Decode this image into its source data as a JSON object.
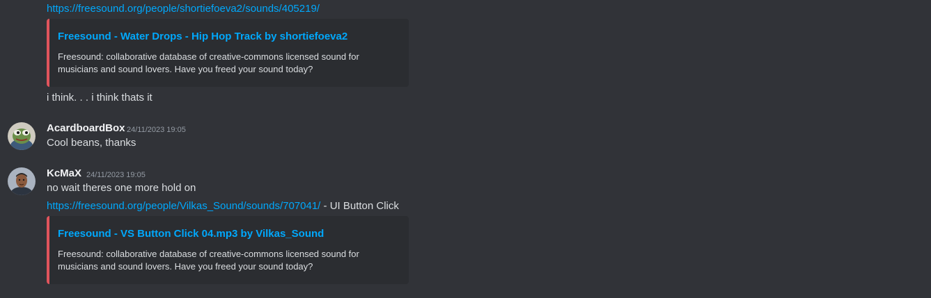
{
  "messages": {
    "first_link": "https://freesound.org/people/shortiefoeva2/sounds/405219/",
    "embed1": {
      "title": "Freesound - Water Drops - Hip Hop Track by shortiefoeva2",
      "description": "Freesound: collaborative database of creative-commons licensed sound for musicians and sound lovers. Have you freed your sound today?"
    },
    "line_think": "i think. . . i think thats it",
    "acard": {
      "username": "AcardboardBox",
      "timestamp": "24/11/2023 19:05",
      "text": "Cool beans, thanks",
      "avatar_icon": "frog-avatar-icon"
    },
    "kcmax": {
      "username": "KcMaX",
      "timestamp": "24/11/2023 19:05",
      "text": "no wait theres one more hold on",
      "link": "https://freesound.org/people/Vilkas_Sound/sounds/707041/",
      "link_suffix": " - UI Button Click",
      "avatar_icon": "person-avatar-icon"
    },
    "embed2": {
      "title": "Freesound - VS Button Click 04.mp3 by Vilkas_Sound",
      "description": "Freesound: collaborative database of creative-commons licensed sound for musicians and sound lovers. Have you freed your sound today?"
    }
  },
  "colors": {
    "background": "#313338",
    "embed_bg": "#2b2d31",
    "embed_accent": "#e0545c",
    "link": "#00a8fc",
    "text": "#dbdee1",
    "muted": "#949ba4"
  }
}
